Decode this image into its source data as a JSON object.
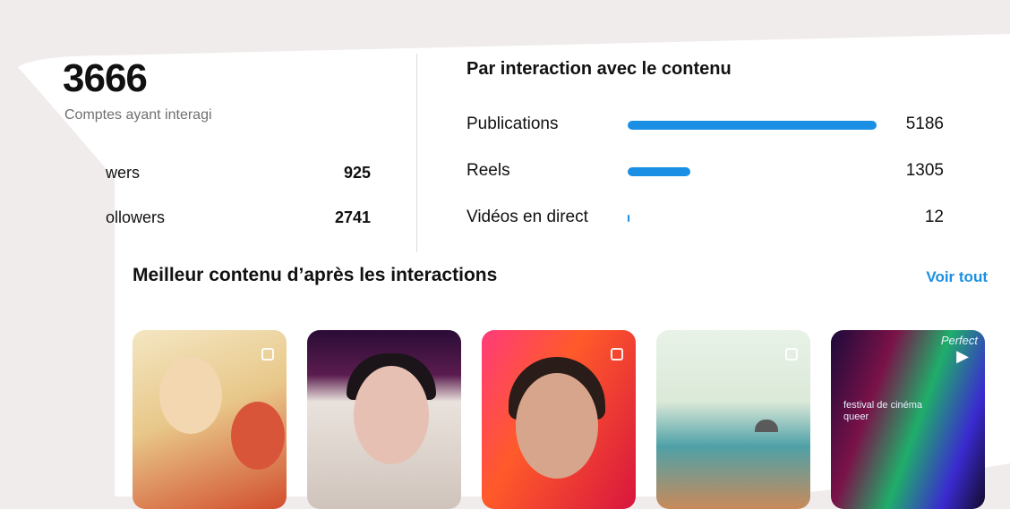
{
  "summary": {
    "total": "3666",
    "total_label": "Comptes ayant interagi",
    "rows": [
      {
        "label": "wers",
        "value": "925"
      },
      {
        "label": "ollowers",
        "value": "2741"
      }
    ]
  },
  "interactions": {
    "title": "Par interaction avec le contenu",
    "accent": "#1a8fe3",
    "rows": [
      {
        "label": "Publications",
        "value": "5186",
        "share": 1.0
      },
      {
        "label": "Reels",
        "value": "1305",
        "share": 0.25
      },
      {
        "label": "Vidéos en direct",
        "value": "12",
        "share": 0.002
      }
    ]
  },
  "best_content": {
    "title": "Meilleur contenu d’après les interactions",
    "see_all": "Voir tout",
    "thumb5_text": "festival de cinéma queer",
    "thumb5_corner": "Perfect"
  }
}
